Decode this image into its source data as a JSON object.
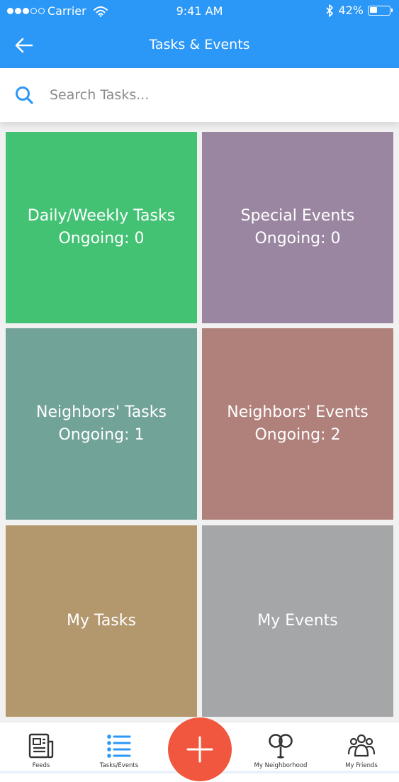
{
  "status_bar": {
    "carrier": "Carrier",
    "time": "9:41 AM",
    "battery_percent": "42%",
    "battery_level": 0.42
  },
  "header": {
    "title": "Tasks & Events"
  },
  "search": {
    "placeholder": "Search Tasks..."
  },
  "tiles": [
    {
      "title": "Daily/Weekly Tasks",
      "subtitle": "Ongoing: 0",
      "color": "#43c274"
    },
    {
      "title": "Special Events",
      "subtitle": "Ongoing: 0",
      "color": "#9a86a1"
    },
    {
      "title": "Neighbors' Tasks",
      "subtitle": "Ongoing: 1",
      "color": "#71a398"
    },
    {
      "title": "Neighbors' Events",
      "subtitle": "Ongoing: 2",
      "color": "#b0807b"
    },
    {
      "title": "My Tasks",
      "subtitle": "",
      "color": "#b3986e"
    },
    {
      "title": "My Events",
      "subtitle": "",
      "color": "#a5a6a8"
    }
  ],
  "bottom_nav": {
    "items": [
      {
        "label": "Feeds",
        "icon": "newspaper-icon",
        "active": false
      },
      {
        "label": "Tasks/Events",
        "icon": "list-icon",
        "active": true
      },
      {
        "label": "My Neighborhood",
        "icon": "neighborhood-pins-icon",
        "active": false
      },
      {
        "label": "My Friends",
        "icon": "friends-group-icon",
        "active": false
      }
    ],
    "fab_icon": "plus-icon"
  },
  "colors": {
    "primary": "#2b97f7",
    "fab": "#f0573e",
    "active_nav": "#2b97f7"
  }
}
